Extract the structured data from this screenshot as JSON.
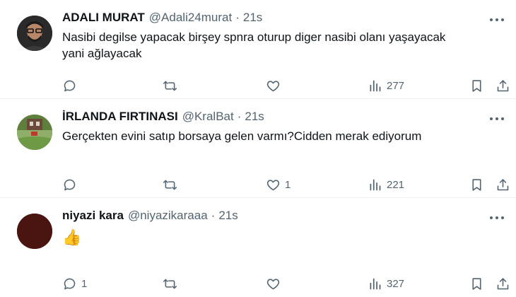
{
  "tweets": [
    {
      "name": "ADALI MURAT",
      "handle": "@Adali24murat",
      "separator": "·",
      "time": "21s",
      "text_lines": [
        "Nasibi degilse yapacak birşey spnra oturup diger nasibi olanı yaşayacak",
        "yani ağlayacak"
      ],
      "replies": "",
      "retweets": "",
      "likes": "",
      "views": "277"
    },
    {
      "name": "İRLANDA FIRTINASI",
      "handle": "@KralBat",
      "separator": "·",
      "time": "21s",
      "text_lines": [
        "Gerçekten evini satıp borsaya gelen varmı?Cidden merak ediyorum"
      ],
      "replies": "",
      "retweets": "",
      "likes": "1",
      "views": "221"
    },
    {
      "name": "niyazi kara",
      "handle": "@niyazikaraaa",
      "separator": "·",
      "time": "21s",
      "text_lines": [
        "👍"
      ],
      "replies": "1",
      "retweets": "",
      "likes": "",
      "views": "327"
    }
  ],
  "icons": {
    "reply": "reply-icon",
    "retweet": "retweet-icon",
    "like": "heart-icon",
    "views": "views-icon",
    "bookmark": "bookmark-icon",
    "share": "share-icon",
    "more": "more-icon"
  },
  "colors": {
    "text": "#0f1419",
    "secondary": "#536471",
    "divider": "#eff3f4"
  }
}
